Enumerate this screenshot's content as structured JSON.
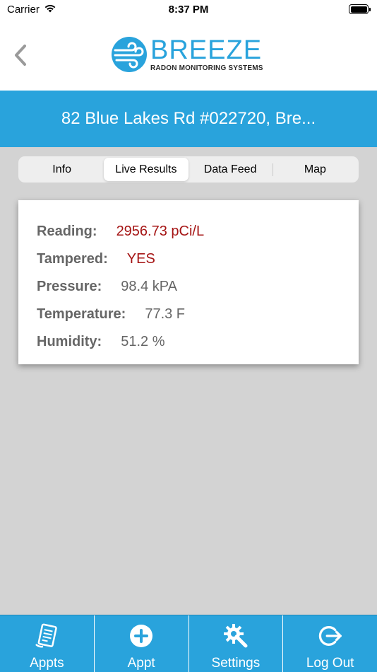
{
  "status_bar": {
    "carrier": "Carrier",
    "time": "8:37 PM"
  },
  "header": {
    "logo_title": "BREEZE",
    "logo_subtitle": "RADON MONITORING SYSTEMS"
  },
  "address": "82 Blue Lakes Rd #022720, Bre...",
  "tabs": [
    {
      "label": "Info",
      "active": false
    },
    {
      "label": "Live Results",
      "active": true
    },
    {
      "label": "Data Feed",
      "active": false
    },
    {
      "label": "Map",
      "active": false
    }
  ],
  "results": [
    {
      "label": "Reading:",
      "value": "2956.73 pCi/L",
      "alert": true
    },
    {
      "label": "Tampered:",
      "value": "YES",
      "alert": true
    },
    {
      "label": "Pressure:",
      "value": "98.4 kPA",
      "alert": false
    },
    {
      "label": "Temperature:",
      "value": "77.3 F",
      "alert": false
    },
    {
      "label": "Humidity:",
      "value": "51.2 %",
      "alert": false
    }
  ],
  "tab_bar": [
    {
      "label": "Appts",
      "icon": "document-icon"
    },
    {
      "label": "Appt",
      "icon": "plus-circle-icon"
    },
    {
      "label": "Settings",
      "icon": "gear-wrench-icon"
    },
    {
      "label": "Log Out",
      "icon": "logout-icon"
    }
  ],
  "colors": {
    "brand_blue": "#29a3dc",
    "alert_red": "#a51414",
    "label_gray": "#666666",
    "background": "#d3d3d3"
  }
}
